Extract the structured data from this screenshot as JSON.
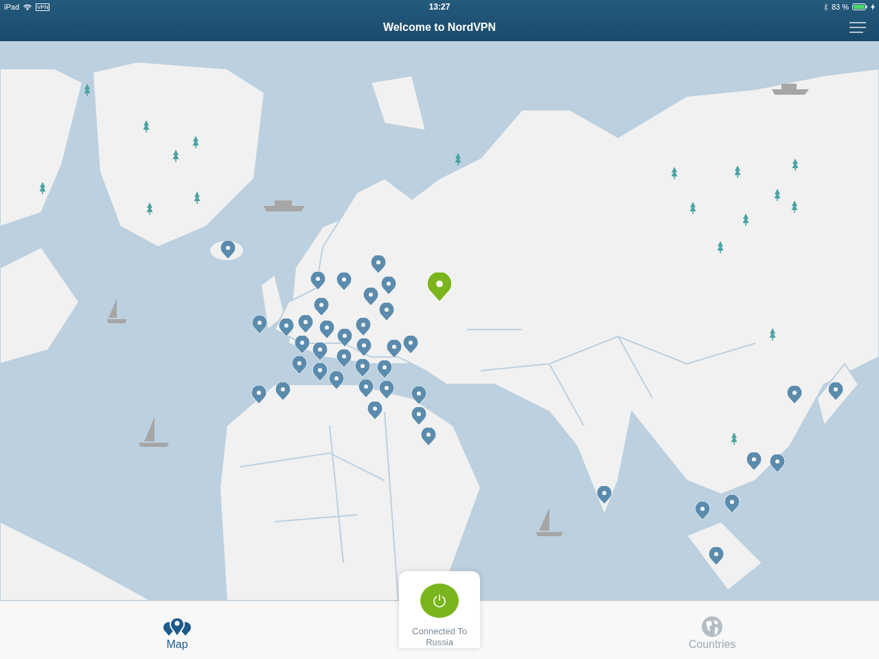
{
  "status_bar": {
    "device": "iPad",
    "vpn": "VPN",
    "time": "13:27",
    "battery": "83 %",
    "charging": true
  },
  "header": {
    "title": "Welcome to NordVPN"
  },
  "map": {
    "pins": [
      {
        "selected": false
      },
      {
        "selected": false
      },
      {
        "selected": false
      },
      {
        "selected": false
      },
      {
        "selected": false
      },
      {
        "selected": false
      },
      {
        "selected": false
      },
      {
        "selected": false
      },
      {
        "selected": false
      },
      {
        "selected": false
      },
      {
        "selected": false
      },
      {
        "selected": false
      },
      {
        "selected": false
      },
      {
        "selected": false
      },
      {
        "selected": false
      },
      {
        "selected": false
      },
      {
        "selected": false
      },
      {
        "selected": false
      },
      {
        "selected": false
      },
      {
        "selected": false
      },
      {
        "selected": false
      },
      {
        "selected": false
      },
      {
        "selected": false
      },
      {
        "selected": false
      },
      {
        "selected": false
      },
      {
        "selected": false
      },
      {
        "selected": false
      },
      {
        "selected": false
      },
      {
        "selected": false
      },
      {
        "selected": false
      },
      {
        "selected": false
      },
      {
        "selected": false
      },
      {
        "selected": false
      },
      {
        "selected": false
      },
      {
        "selected": false
      },
      {
        "selected": false
      },
      {
        "selected": false
      },
      {
        "selected": false
      },
      {
        "selected": false
      },
      {
        "selected": false
      },
      {
        "selected": false
      },
      {
        "selected": true
      }
    ]
  },
  "tabs": [
    {
      "kind": "map",
      "label": "Map",
      "selected": true
    },
    {
      "kind": "countries",
      "label": "Countries",
      "selected": false
    }
  ],
  "connect": {
    "connected": true,
    "status": "Connected To Russia"
  }
}
